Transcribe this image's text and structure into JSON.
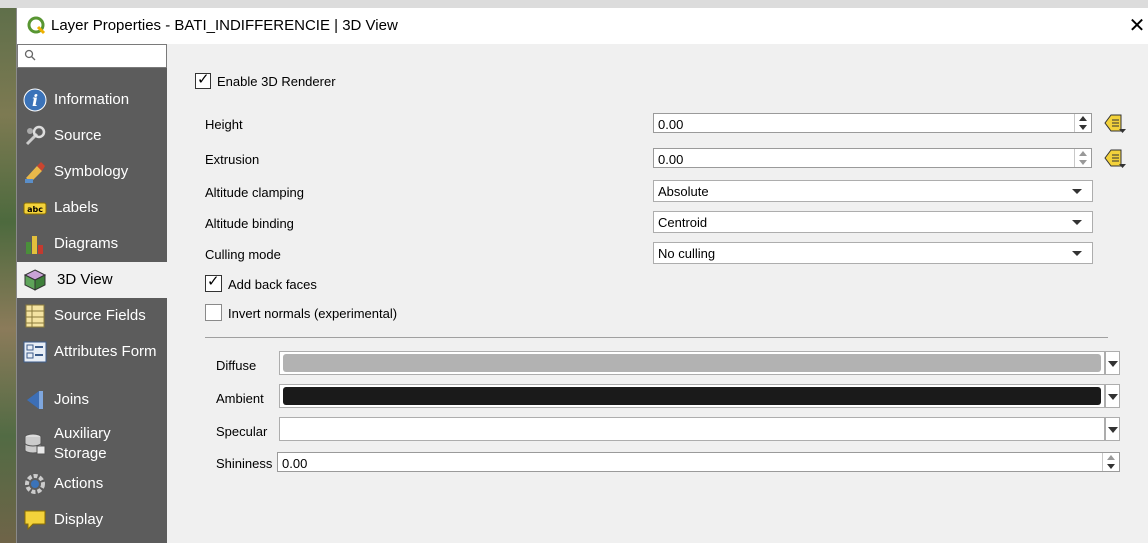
{
  "window": {
    "title": "Layer Properties - BATI_INDIFFERENCIE | 3D View",
    "close_glyph": "✕"
  },
  "sidebar": {
    "search_placeholder": "",
    "items": [
      {
        "label": "Information",
        "icon": "information-icon",
        "active": false
      },
      {
        "label": "Source",
        "icon": "source-icon",
        "active": false
      },
      {
        "label": "Symbology",
        "icon": "symbology-icon",
        "active": false
      },
      {
        "label": "Labels",
        "icon": "labels-icon",
        "active": false
      },
      {
        "label": "Diagrams",
        "icon": "diagrams-icon",
        "active": false
      },
      {
        "label": "3D View",
        "icon": "3d-view-icon",
        "active": true
      },
      {
        "label": "Source Fields",
        "icon": "source-fields-icon",
        "active": false
      },
      {
        "label": "Attributes Form",
        "icon": "attributes-form-icon",
        "active": false
      },
      {
        "label": "Joins",
        "icon": "joins-icon",
        "active": false
      },
      {
        "label": "Auxiliary Storage",
        "icon": "auxiliary-storage-icon",
        "active": false
      },
      {
        "label": "Actions",
        "icon": "actions-icon",
        "active": false
      },
      {
        "label": "Display",
        "icon": "display-icon",
        "active": false
      }
    ]
  },
  "renderer": {
    "enable_label": "Enable 3D Renderer",
    "enable_checked": true,
    "height": {
      "label": "Height",
      "value": "0.00"
    },
    "extrusion": {
      "label": "Extrusion",
      "value": "0.00"
    },
    "altitude_clamping": {
      "label": "Altitude clamping",
      "value": "Absolute"
    },
    "altitude_binding": {
      "label": "Altitude binding",
      "value": "Centroid"
    },
    "culling_mode": {
      "label": "Culling mode",
      "value": "No culling"
    },
    "add_back_faces": {
      "label": "Add back faces",
      "checked": true
    },
    "invert_normals": {
      "label": "Invert normals (experimental)",
      "checked": false
    }
  },
  "material": {
    "diffuse": {
      "label": "Diffuse",
      "color": "#b2b2b2"
    },
    "ambient": {
      "label": "Ambient",
      "color": "#1a1a1a"
    },
    "specular": {
      "label": "Specular",
      "color": "#ffffff"
    },
    "shininess": {
      "label": "Shininess",
      "value": "0.00"
    }
  },
  "colors": {
    "sidebar_bg": "#5c5c5c",
    "active_bg": "#f0f0f0",
    "dialog_bg": "#f0f0f0"
  }
}
